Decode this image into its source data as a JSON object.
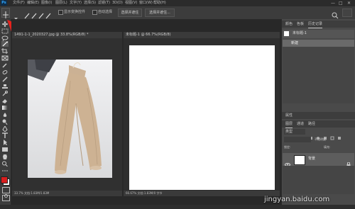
{
  "app": {
    "logo": "Ps"
  },
  "menubar": {
    "items": [
      "文件(F)",
      "编辑(E)",
      "图像(I)",
      "图层(L)",
      "文字(Y)",
      "选择(S)",
      "滤镜(T)",
      "3D(D)",
      "视图(V)",
      "窗口(W)",
      "帮助(H)"
    ],
    "window_controls": [
      "—",
      "□",
      "✕"
    ]
  },
  "options": {
    "auto_select_label": "自动选择",
    "show_transform_label": "显示变换控件",
    "button1": "选择并遮住",
    "button2": "选择并遮住..."
  },
  "documents": [
    {
      "tab_title": "1491-1-1_2020327.jpg @ 33.8%(RGB/8) *",
      "status": "33.7%    文档:1.83M/1.83M"
    },
    {
      "tab_title": "未标题-1 @ 66.7%(RGB/8)",
      "status": "66.67%    文档:1.83M/0 字节"
    }
  ],
  "panels": {
    "top_tabs": [
      "颜色",
      "色板",
      "历史记录"
    ],
    "history_item": "未标题-1",
    "history_step": "新建",
    "layers_tabs": [
      "图层",
      "通道",
      "路径"
    ],
    "mid_tab": "属性",
    "layer_name": "背景",
    "kind_label": "类型",
    "opacity_label": "不透明度:",
    "fill_label": "填充:",
    "lock_label": "锁定:"
  },
  "watermark": "jingyan.baidu.com",
  "colors": {
    "annotation_arrow": "#e8221c",
    "foreground": "#d81e1e",
    "background": "#ffffff",
    "accent": "#31a8ff"
  },
  "icons": [
    "move-icon",
    "marquee-icon",
    "lasso-icon",
    "magic-wand-icon",
    "crop-icon",
    "eyedropper-icon",
    "healing-icon",
    "brush-icon",
    "stamp-icon",
    "history-brush-icon",
    "eraser-icon",
    "gradient-icon",
    "blur-icon",
    "dodge-icon",
    "pen-icon",
    "type-icon",
    "path-select-icon",
    "shape-icon",
    "hand-icon",
    "zoom-icon",
    "eye-icon",
    "trash-icon"
  ]
}
